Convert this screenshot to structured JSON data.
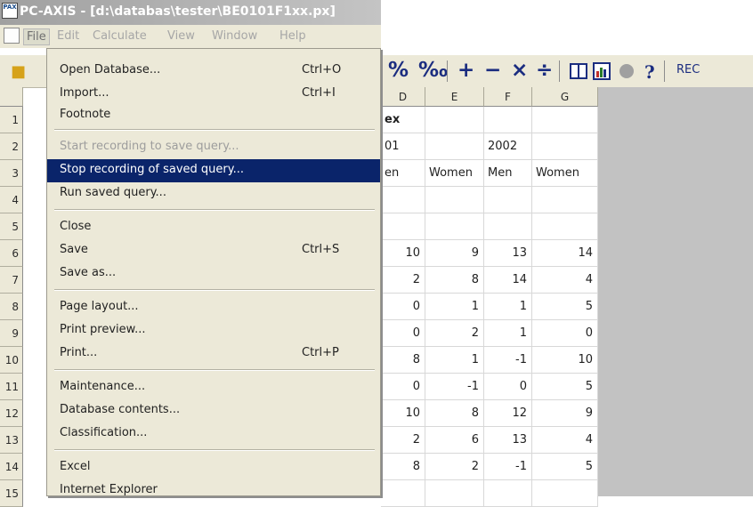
{
  "window": {
    "app_icon_text": "PAX",
    "title": "PC-AXIS - [d:\\databas\\tester\\BE0101F1xx.px]"
  },
  "menubar": {
    "items": [
      "File",
      "Edit",
      "Calculate",
      "View",
      "Window",
      "Help"
    ]
  },
  "toolbar": {
    "buttons": [
      "%",
      "‰",
      "+",
      "−",
      "×",
      "÷"
    ],
    "rec_label": "REC",
    "icons": [
      "open-folder-icon",
      "table-icon",
      "chart-icon",
      "record-icon",
      "help-icon"
    ]
  },
  "grid": {
    "columns": [
      "D",
      "E",
      "F",
      "G"
    ],
    "row_numbers": [
      "1",
      "2",
      "3",
      "4",
      "5",
      "6",
      "7",
      "8",
      "9",
      "10",
      "11",
      "12",
      "13",
      "14",
      "15"
    ],
    "rows": [
      [
        "ex",
        "",
        "",
        ""
      ],
      [
        "01",
        "",
        "2002",
        ""
      ],
      [
        "en",
        "Women",
        "Men",
        "Women"
      ],
      [
        "",
        "",
        "",
        ""
      ],
      [
        "",
        "",
        "",
        ""
      ],
      [
        "10",
        "9",
        "13",
        "14"
      ],
      [
        "2",
        "8",
        "14",
        "4"
      ],
      [
        "0",
        "1",
        "1",
        "5"
      ],
      [
        "0",
        "2",
        "1",
        "0"
      ],
      [
        "8",
        "1",
        "-1",
        "10"
      ],
      [
        "0",
        "-1",
        "0",
        "5"
      ],
      [
        "10",
        "8",
        "12",
        "9"
      ],
      [
        "2",
        "6",
        "13",
        "4"
      ],
      [
        "8",
        "2",
        "-1",
        "5"
      ],
      [
        "",
        "",
        "",
        ""
      ]
    ]
  },
  "file_menu": {
    "items": [
      {
        "label": "Open Database...",
        "shortcut": "Ctrl+O"
      },
      {
        "label": "Import...",
        "shortcut": "Ctrl+I"
      },
      {
        "label": "Footnote",
        "shortcut": ""
      },
      {
        "label": "Start recording to save query...",
        "shortcut": "",
        "state": "disabled"
      },
      {
        "label": "Stop recording of saved query...",
        "shortcut": "",
        "state": "selected"
      },
      {
        "label": "Run saved query...",
        "shortcut": ""
      },
      {
        "label": "Close",
        "shortcut": ""
      },
      {
        "label": "Save",
        "shortcut": "Ctrl+S"
      },
      {
        "label": "Save as...",
        "shortcut": ""
      },
      {
        "label": "Page layout...",
        "shortcut": ""
      },
      {
        "label": "Print preview...",
        "shortcut": ""
      },
      {
        "label": "Print...",
        "shortcut": "Ctrl+P"
      },
      {
        "label": "Maintenance...",
        "shortcut": ""
      },
      {
        "label": "Database contents...",
        "shortcut": ""
      },
      {
        "label": "Classification...",
        "shortcut": ""
      },
      {
        "label": "Excel",
        "shortcut": ""
      },
      {
        "label": "Internet Explorer",
        "shortcut": ""
      }
    ]
  },
  "colors": {
    "selection": "#0a246a",
    "menu_bg": "#ece9d8",
    "toolbar_icon": "#1b2d80"
  }
}
